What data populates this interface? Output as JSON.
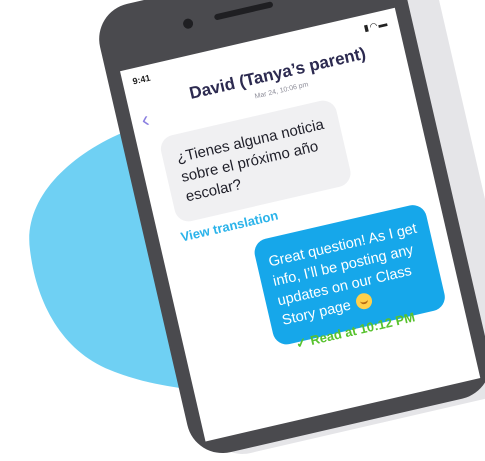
{
  "colors": {
    "blob": "#6fd0f3",
    "phone": "#4a4a4e",
    "screen": "#ffffff",
    "incoming_bubble": "#f0f0f2",
    "outgoing_bubble": "#16a7ea",
    "accent_purple": "#8a7fe0",
    "link_blue": "#2ab3ea",
    "read_green": "#58c22e"
  },
  "status_bar": {
    "time": "9:41",
    "icons": "signal-wifi-battery"
  },
  "header": {
    "title": "David (Tanya’s parent)",
    "subtitle": "Mar 24, 10:06 pm"
  },
  "messages": [
    {
      "direction": "incoming",
      "text": "¿Tienes alguna noticia sobre el próximo año escolar?",
      "action": "View translation"
    },
    {
      "direction": "outgoing",
      "text": "Great question! As I get info, I’ll be posting any updates on our Class Story page",
      "emoji": "smiling-face"
    }
  ],
  "read_receipt": {
    "check": "✓",
    "label": "Read at 10:12 PM"
  }
}
